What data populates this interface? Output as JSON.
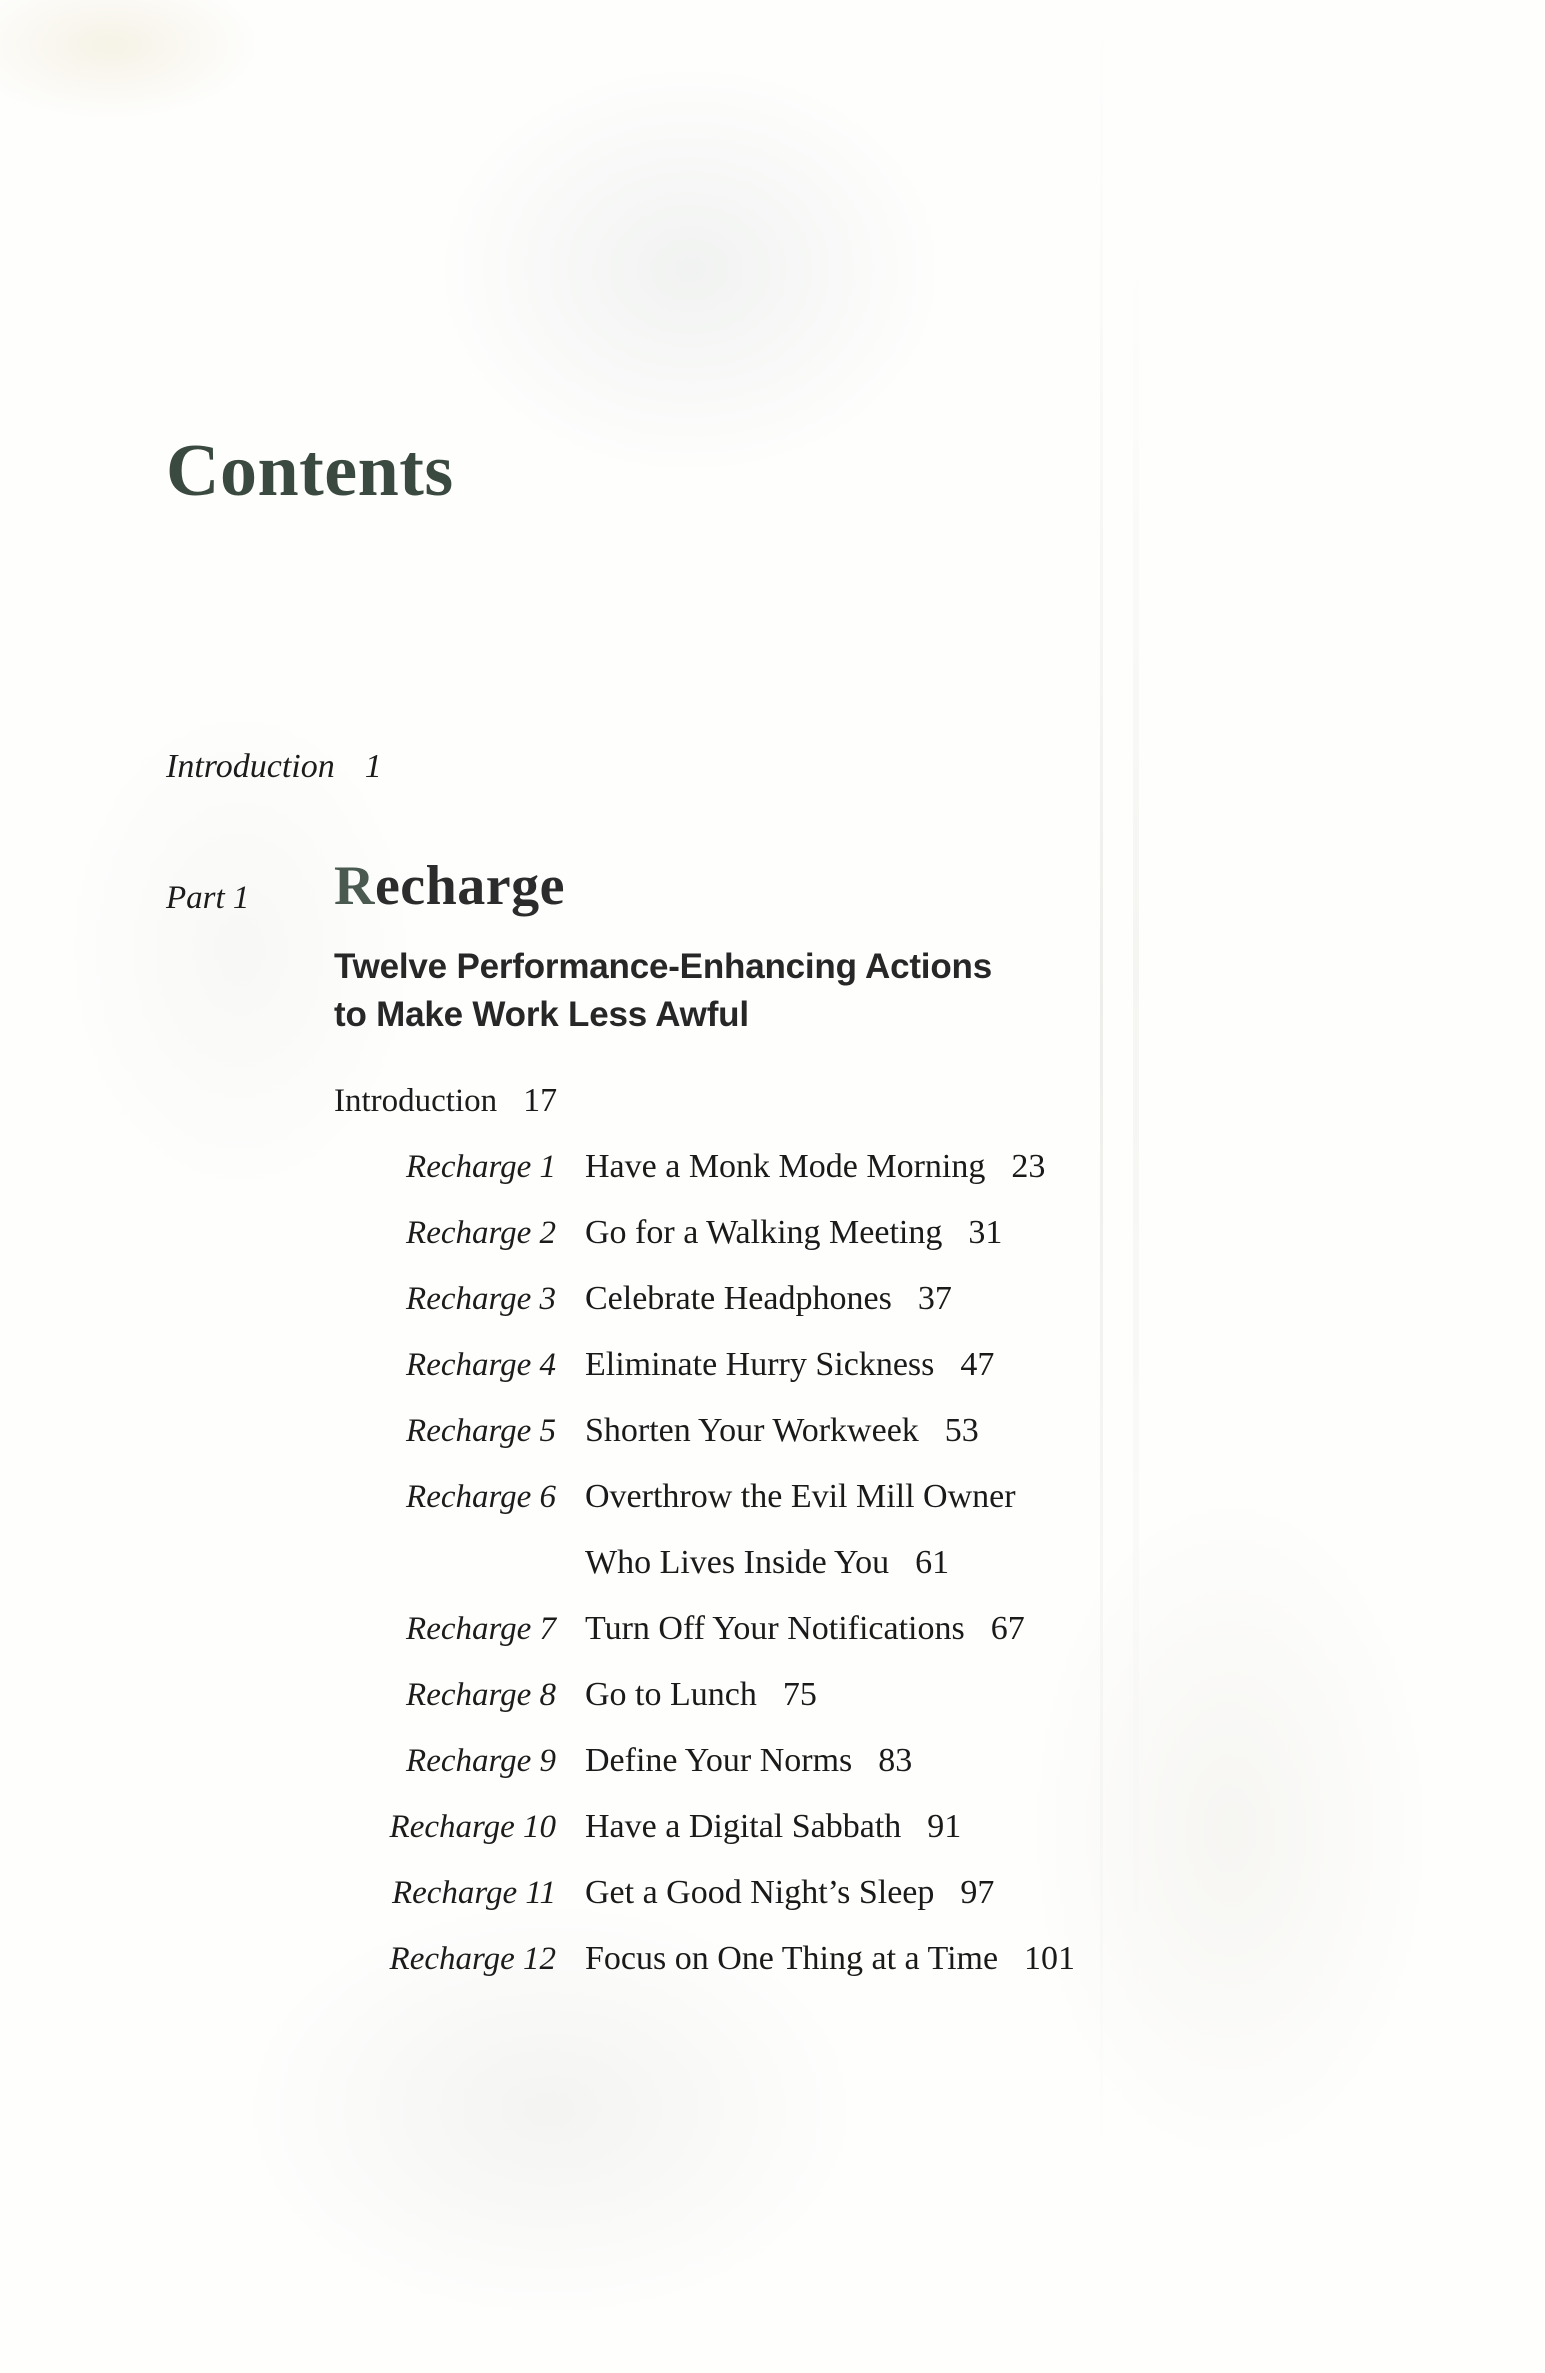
{
  "page": {
    "title": "Contents",
    "title_color": "#3b4a40",
    "background_color": "#fefefd",
    "text_color": "#1a1a1a"
  },
  "frontmatter": {
    "label": "Introduction",
    "page": "1"
  },
  "part": {
    "label": "Part 1",
    "title_drop_cap": "R",
    "title_rest": "echarge",
    "title_full": "Recharge",
    "subtitle_line_1": "Twelve Performance-Enhancing Actions",
    "subtitle_line_2": "to Make Work Less Awful",
    "intro": {
      "label": "Introduction",
      "page": "17"
    }
  },
  "chapters": [
    {
      "label": "Recharge 1",
      "title": "Have a Monk Mode Morning",
      "page": "23",
      "continuation": null,
      "continuation_page": null
    },
    {
      "label": "Recharge 2",
      "title": "Go for a Walking Meeting",
      "page": "31",
      "continuation": null,
      "continuation_page": null
    },
    {
      "label": "Recharge 3",
      "title": "Celebrate Headphones",
      "page": "37",
      "continuation": null,
      "continuation_page": null
    },
    {
      "label": "Recharge 4",
      "title": "Eliminate Hurry Sickness",
      "page": "47",
      "continuation": null,
      "continuation_page": null
    },
    {
      "label": "Recharge 5",
      "title": "Shorten Your Workweek",
      "page": "53",
      "continuation": null,
      "continuation_page": null
    },
    {
      "label": "Recharge 6",
      "title": "Overthrow the Evil Mill Owner",
      "page": "",
      "continuation": "Who Lives Inside You",
      "continuation_page": "61"
    },
    {
      "label": "Recharge 7",
      "title": "Turn Off Your Notifications",
      "page": "67",
      "continuation": null,
      "continuation_page": null
    },
    {
      "label": "Recharge 8",
      "title": "Go to Lunch",
      "page": "75",
      "continuation": null,
      "continuation_page": null
    },
    {
      "label": "Recharge 9",
      "title": "Define Your Norms",
      "page": "83",
      "continuation": null,
      "continuation_page": null
    },
    {
      "label": "Recharge 10",
      "title": "Have a Digital Sabbath",
      "page": "91",
      "continuation": null,
      "continuation_page": null
    },
    {
      "label": "Recharge 11",
      "title": "Get a Good Night’s Sleep",
      "page": "97",
      "continuation": null,
      "continuation_page": null
    },
    {
      "label": "Recharge 12",
      "title": "Focus on One Thing at a Time",
      "page": "101",
      "continuation": null,
      "continuation_page": null
    }
  ]
}
